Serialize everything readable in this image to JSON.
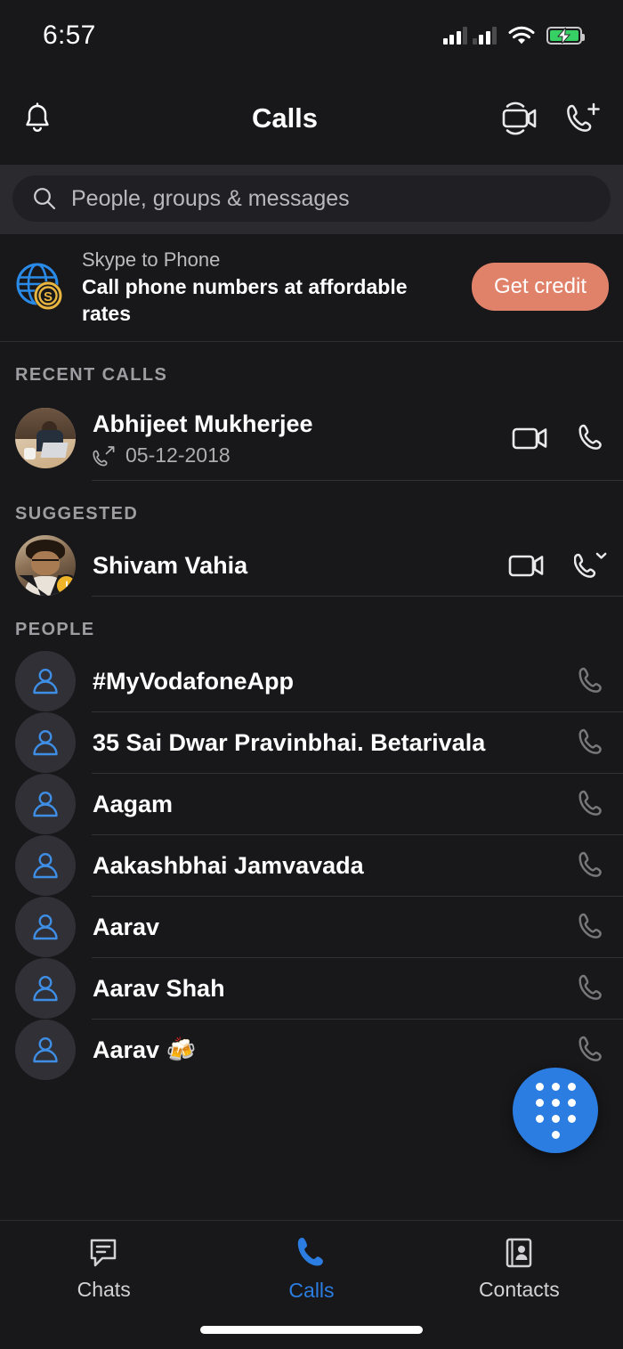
{
  "status_bar": {
    "time": "6:57",
    "signal_icon": "cellular-signal-icon",
    "wifi_icon": "wifi-icon",
    "battery_icon": "battery-charging-icon",
    "battery_color": "#36d065"
  },
  "header": {
    "title": "Calls",
    "bell_icon": "notification-bell-icon",
    "video_icon": "new-meeting-video-icon",
    "add_call_icon": "new-call-phone-plus-icon"
  },
  "search": {
    "placeholder": "People, groups & messages",
    "icon": "search-icon"
  },
  "banner": {
    "icon": "globe-coin-icon",
    "title": "Skype to Phone",
    "subtitle": "Call phone numbers at affordable rates",
    "button_label": "Get credit",
    "button_color": "#e0826a"
  },
  "sections": {
    "recent_calls": {
      "header": "RECENT CALLS",
      "items": [
        {
          "name": "Abhijeet Mukherjee",
          "call_direction_icon": "outgoing-call-icon",
          "date": "05-12-2018",
          "actions": [
            "video-call-icon",
            "audio-call-icon"
          ]
        }
      ]
    },
    "suggested": {
      "header": "SUGGESTED",
      "items": [
        {
          "name": "Shivam Vahia",
          "presence": "away",
          "presence_icon": "clock-away-icon",
          "actions": [
            "video-call-icon",
            "audio-call-dropdown-icon"
          ]
        }
      ]
    },
    "people": {
      "header": "PEOPLE",
      "items": [
        {
          "name": "#MyVodafoneApp",
          "avatar_icon": "person-placeholder-icon",
          "action": "audio-call-icon"
        },
        {
          "name": "35 Sai Dwar Pravinbhai. Betarivala",
          "avatar_icon": "person-placeholder-icon",
          "action": "audio-call-icon"
        },
        {
          "name": "Aagam",
          "avatar_icon": "person-placeholder-icon",
          "action": "audio-call-icon"
        },
        {
          "name": "Aakashbhai Jamvavada",
          "avatar_icon": "person-placeholder-icon",
          "action": "audio-call-icon"
        },
        {
          "name": "Aarav",
          "avatar_icon": "person-placeholder-icon",
          "action": "audio-call-icon"
        },
        {
          "name": "Aarav Shah",
          "avatar_icon": "person-placeholder-icon",
          "action": "audio-call-icon"
        },
        {
          "name": "Aarav 🍻",
          "avatar_icon": "person-placeholder-icon",
          "action": "audio-call-icon"
        }
      ]
    }
  },
  "fab": {
    "icon": "dialpad-icon",
    "color": "#2b7de1"
  },
  "bottom_nav": {
    "active": "Calls",
    "accent_color": "#2b7de1",
    "tabs": [
      {
        "label": "Chats",
        "icon": "chat-bubble-icon"
      },
      {
        "label": "Calls",
        "icon": "phone-icon"
      },
      {
        "label": "Contacts",
        "icon": "address-book-icon"
      }
    ]
  }
}
